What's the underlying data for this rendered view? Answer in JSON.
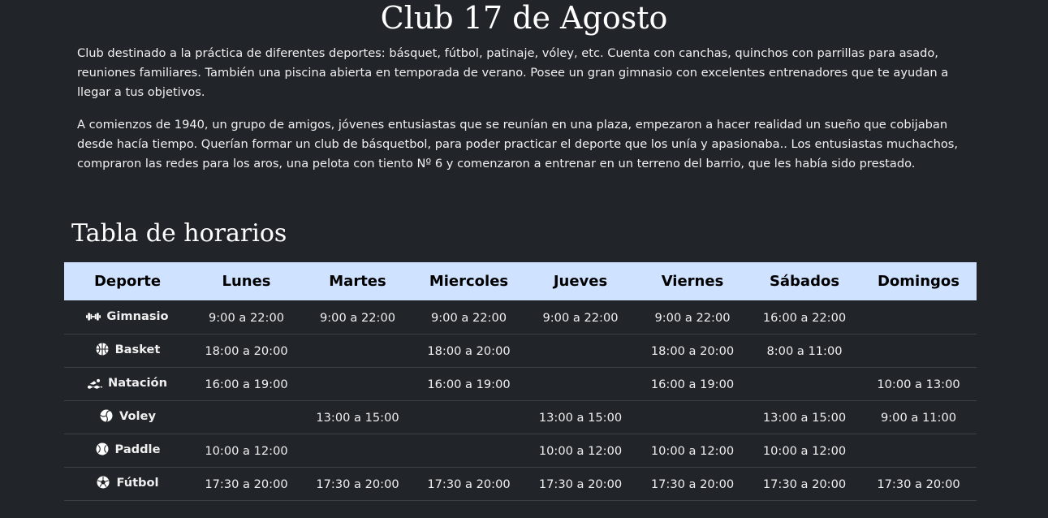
{
  "header": {
    "title": "Club 17 de Agosto"
  },
  "intro": {
    "p1": "Club destinado a la práctica de diferentes deportes: básquet, fútbol, patinaje, vóley, etc. Cuenta con canchas, quinchos con parrillas para asado, reuniones familiares. También una piscina abierta en temporada de verano. Posee un gran gimnasio con excelentes entrenadores que te ayudan a llegar a tus objetivos.",
    "p2": "A comienzos de 1940, un grupo de amigos, jóvenes entusiastas que se reunían en una plaza, empezaron a hacer realidad un sueño que cobijaban desde hacía tiempo. Querían formar un club de básquetbol, para poder practicar el deporte que los unía y apasionaba.. Los entusiastas muchachos, compraron las redes para los aros, una pelota con tiento Nº 6 y comenzaron a entrenar en un terreno del barrio, que les había sido prestado."
  },
  "schedule": {
    "title": "Tabla de horarios",
    "headers": [
      "Deporte",
      "Lunes",
      "Martes",
      "Miercoles",
      "Jueves",
      "Viernes",
      "Sábados",
      "Domingos"
    ],
    "rows": [
      {
        "sport": "Gimnasio",
        "icon": "dumbbell-icon",
        "times": [
          "9:00 a 22:00",
          "9:00 a 22:00",
          "9:00 a 22:00",
          "9:00 a 22:00",
          "9:00 a 22:00",
          "16:00 a 22:00",
          ""
        ]
      },
      {
        "sport": "Basket",
        "icon": "basketball-icon",
        "times": [
          "18:00 a 20:00",
          "",
          "18:00 a 20:00",
          "",
          "18:00 a 20:00",
          "8:00 a 11:00",
          ""
        ]
      },
      {
        "sport": "Natación",
        "icon": "swimmer-icon",
        "times": [
          "16:00 a 19:00",
          "",
          "16:00 a 19:00",
          "",
          "16:00 a 19:00",
          "",
          "10:00 a 13:00"
        ]
      },
      {
        "sport": "Voley",
        "icon": "volleyball-icon",
        "times": [
          "",
          "13:00 a 15:00",
          "",
          "13:00 a 15:00",
          "",
          "13:00 a 15:00",
          "9:00 a 11:00"
        ]
      },
      {
        "sport": "Paddle",
        "icon": "paddle-ball-icon",
        "times": [
          "10:00 a 12:00",
          "",
          "",
          "10:00 a 12:00",
          "10:00 a 12:00",
          "10:00 a 12:00",
          ""
        ]
      },
      {
        "sport": "Fútbol",
        "icon": "soccer-ball-icon",
        "times": [
          "17:30 a 20:00",
          "17:30 a 20:00",
          "17:30 a 20:00",
          "17:30 a 20:00",
          "17:30 a 20:00",
          "17:30 a 20:00",
          "17:30 a 20:00"
        ]
      }
    ]
  }
}
